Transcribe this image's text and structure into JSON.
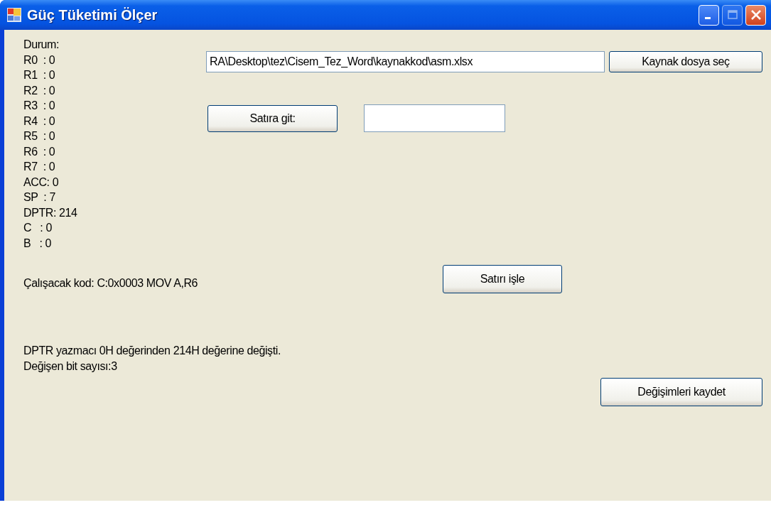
{
  "window": {
    "title": "Güç Tüketimi Ölçer",
    "controls": [
      {
        "kind": "minimize",
        "disabled": false
      },
      {
        "kind": "maximize",
        "disabled": true
      },
      {
        "kind": "close",
        "disabled": false
      }
    ]
  },
  "status_lines": [
    "Durum:",
    "R0  : 0",
    "R1  : 0",
    "R2  : 0",
    "R3  : 0",
    "R4  : 0",
    "R5  : 0",
    "R6  : 0",
    "R7  : 0",
    "ACC: 0",
    "SP  : 7",
    "DPTR: 214",
    "C   : 0",
    "B   : 0"
  ],
  "source_file": {
    "value": "RA\\Desktop\\tez\\Cisem_Tez_Word\\kaynakkod\\asm.xlsx",
    "button": "Kaynak dosya seç"
  },
  "goto_line": {
    "button": "Satıra git:"
  },
  "code_label": "Çalışacak kod: C:0x0003 MOV A,R6",
  "process_button": "Satırı işle",
  "messages": [
    "DPTR yazmacı 0H değerinden 214H değerine değişti.",
    "Değişen bit sayısı:3"
  ],
  "save_button": "Değişimleri kaydet"
}
